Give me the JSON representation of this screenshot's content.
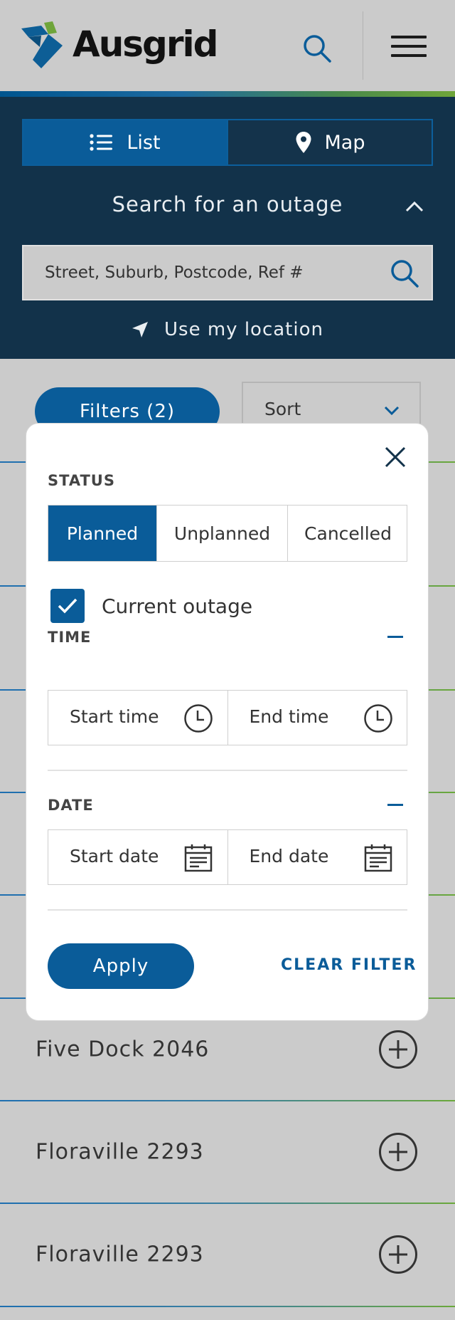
{
  "header": {
    "brand": "Ausgrid",
    "search_icon": "search-icon",
    "menu_icon": "hamburger-menu-icon",
    "accent_colors": [
      "#00558f",
      "#6fa53a"
    ]
  },
  "view_toggle": {
    "list_label": "List",
    "map_label": "Map",
    "active": "List"
  },
  "search": {
    "title": "Search for an outage",
    "placeholder": "Street, Suburb, Postcode, Ref #",
    "use_location": "Use my location"
  },
  "list": {
    "filters_label": "Filters (2)",
    "sort_label": "Sort",
    "rows": [
      {
        "name": "Five Dock 2046"
      },
      {
        "name": "Floraville 2293"
      },
      {
        "name": "Floraville 2293"
      }
    ]
  },
  "filter_modal": {
    "status_heading": "STATUS",
    "status_options": [
      "Planned",
      "Unplanned",
      "Cancelled"
    ],
    "status_selected": "Planned",
    "current_outage_label": "Current outage",
    "current_outage_checked": true,
    "time_heading": "TIME",
    "start_time": "Start time",
    "end_time": "End time",
    "date_heading": "DATE",
    "start_date": "Start date",
    "end_date": "End date",
    "apply_label": "Apply",
    "clear_label": "CLEAR FILTER"
  },
  "colors": {
    "primary": "#0a5c99",
    "panel": "#12324a",
    "overlay": "#cbcbcb"
  }
}
